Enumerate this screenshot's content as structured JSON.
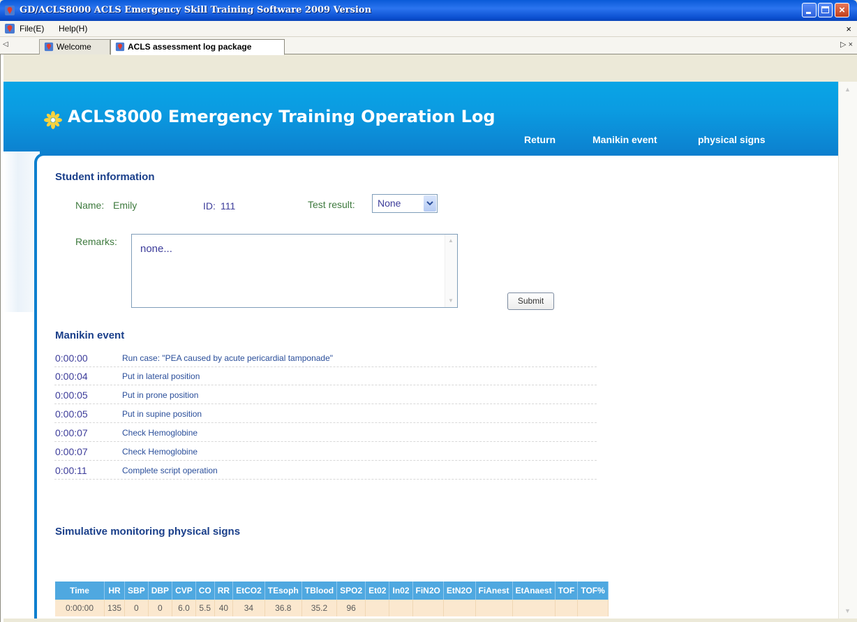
{
  "window": {
    "title": "GD/ACLS8000 ACLS Emergency Skill Training Software 2009 Version",
    "close_glyph": "×"
  },
  "menubar": {
    "items": [
      "File(E)",
      "Help(H)"
    ],
    "close_glyph": "×"
  },
  "tabs": [
    {
      "label": "Welcome",
      "active": false
    },
    {
      "label": "ACLS assessment log package",
      "active": true
    }
  ],
  "tabbar": {
    "left_glyph": "◁",
    "right_glyph": "▷ ×"
  },
  "header": {
    "title": "ACLS8000 Emergency Training Operation Log",
    "nav": [
      "Return",
      "Manikin event",
      "physical signs"
    ]
  },
  "student": {
    "section_title": "Student information",
    "name_label": "Name:",
    "name": "Emily",
    "id_label": "ID:",
    "id": "111",
    "result_label": "Test result:",
    "result_value": "None",
    "remarks_label": "Remarks:",
    "remarks": "none...",
    "submit_label": "Submit"
  },
  "manikin": {
    "section_title": "Manikin event",
    "events": [
      {
        "time": "0:00:00",
        "desc": "Run case: \"PEA caused by acute pericardial tamponade\""
      },
      {
        "time": "0:00:04",
        "desc": "Put in lateral position"
      },
      {
        "time": "0:00:05",
        "desc": "Put in prone position"
      },
      {
        "time": "0:00:05",
        "desc": "Put in supine position"
      },
      {
        "time": "0:00:07",
        "desc": "Check Hemoglobine"
      },
      {
        "time": "0:00:07",
        "desc": "Check Hemoglobine"
      },
      {
        "time": "0:00:11",
        "desc": "Complete script operation"
      }
    ]
  },
  "signs": {
    "section_title": "Simulative monitoring physical signs",
    "columns": [
      "Time",
      "HR",
      "SBP",
      "DBP",
      "CVP",
      "CO",
      "RR",
      "EtCO2",
      "TEsoph",
      "TBlood",
      "SPO2",
      "Et02",
      "In02",
      "FiN2O",
      "EtN2O",
      "FiAnest",
      "EtAnaest",
      "TOF",
      "TOF%"
    ],
    "rows": [
      [
        "0:00:00",
        "135",
        "0",
        "0",
        "6.0",
        "5.5",
        "40",
        "34",
        "36.8",
        "35.2",
        "96",
        "",
        "",
        "",
        "",
        "",
        "",
        "",
        ""
      ]
    ]
  },
  "colors": {
    "header_blue": "#0b9be1",
    "section_title": "#1a3f8a",
    "table_header": "#4fa8e0",
    "table_row": "#fbe8cf"
  }
}
